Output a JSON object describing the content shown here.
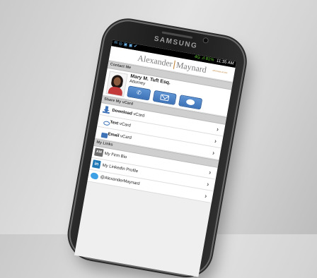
{
  "device": {
    "brand": "SAMSUNG"
  },
  "status_bar": {
    "left_icons": "✉ ◎ ▣ ▣ ✔",
    "signal": "4G .ıl 81%",
    "time": "11:35 AM"
  },
  "app": {
    "logo_left": "Alexander",
    "logo_right": "Maynard",
    "tagline": "attorneys at law"
  },
  "contact": {
    "header": "Contact Me",
    "name": "Mary M. Tuft Esq.",
    "title": "Attorney",
    "buttons": [
      {
        "name": "call",
        "icon": "phone-icon",
        "glyph": "✆"
      },
      {
        "name": "email",
        "icon": "envelope-icon"
      },
      {
        "name": "message",
        "icon": "chat-bubble-icon"
      }
    ]
  },
  "share": {
    "header": "Share My vCard",
    "items": [
      {
        "bold": "Download",
        "rest": " vCard",
        "icon": "download-icon"
      },
      {
        "bold": "Text",
        "rest": " vCard",
        "icon": "chat-bubble-icon"
      },
      {
        "bold": "Email",
        "rest": " vCard",
        "icon": "envelope-icon"
      }
    ]
  },
  "links": {
    "header": "My Links",
    "items": [
      {
        "label": "My Firm Bio",
        "icon_text": "AM",
        "icon": "firm-logo-icon"
      },
      {
        "label": "My LinkedIn Profile",
        "icon_text": "in",
        "icon": "linkedin-icon"
      },
      {
        "label": "@AlexanderMaynard",
        "icon": "twitter-icon"
      }
    ]
  },
  "colors": {
    "accent_blue": "#3e73b8",
    "logo_gold": "#c0873b",
    "section_gray": "#cfcfcf"
  }
}
